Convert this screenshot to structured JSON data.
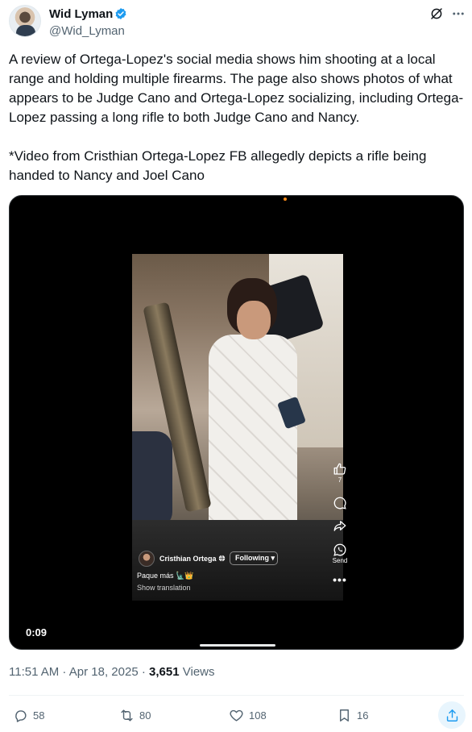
{
  "author": {
    "display_name": "Wid Lyman",
    "handle": "@Wid_Lyman",
    "verified_color": "#1d9bf0"
  },
  "post": {
    "paragraphs": [
      "A review of Ortega-Lopez's social media shows him shooting at a local range and holding multiple firearms. The page also shows photos of what appears to be Judge Cano and Ortega-Lopez socializing, including Ortega-Lopez passing a long rifle to both Judge Cano and Nancy.",
      "*Video from Cristhian Ortega-Lopez FB allegedly depicts a rifle being handed to Nancy and Joel Cano"
    ]
  },
  "video": {
    "timestamp": "0:09",
    "fb_overlay": {
      "name": "Cristhian Ortega",
      "follow_label": "Following ▾",
      "caption": "Paque más 🗽👑",
      "translation": "Show translation"
    },
    "side_actions": {
      "like_count": "7",
      "send_label": "Send"
    }
  },
  "meta": {
    "time": "11:51 AM",
    "date": "Apr 18, 2025",
    "separator": " · ",
    "views_count": "3,651",
    "views_label": "Views"
  },
  "actions": {
    "replies": "58",
    "reposts": "80",
    "likes": "108",
    "bookmarks": "16"
  },
  "icons": [
    "verified-icon",
    "grok-icon",
    "more-icon",
    "reply-icon",
    "repost-icon",
    "like-icon",
    "bookmark-icon",
    "share-icon"
  ],
  "colors": {
    "text_primary": "#0f1419",
    "text_secondary": "#536471",
    "accent": "#1d9bf0"
  }
}
